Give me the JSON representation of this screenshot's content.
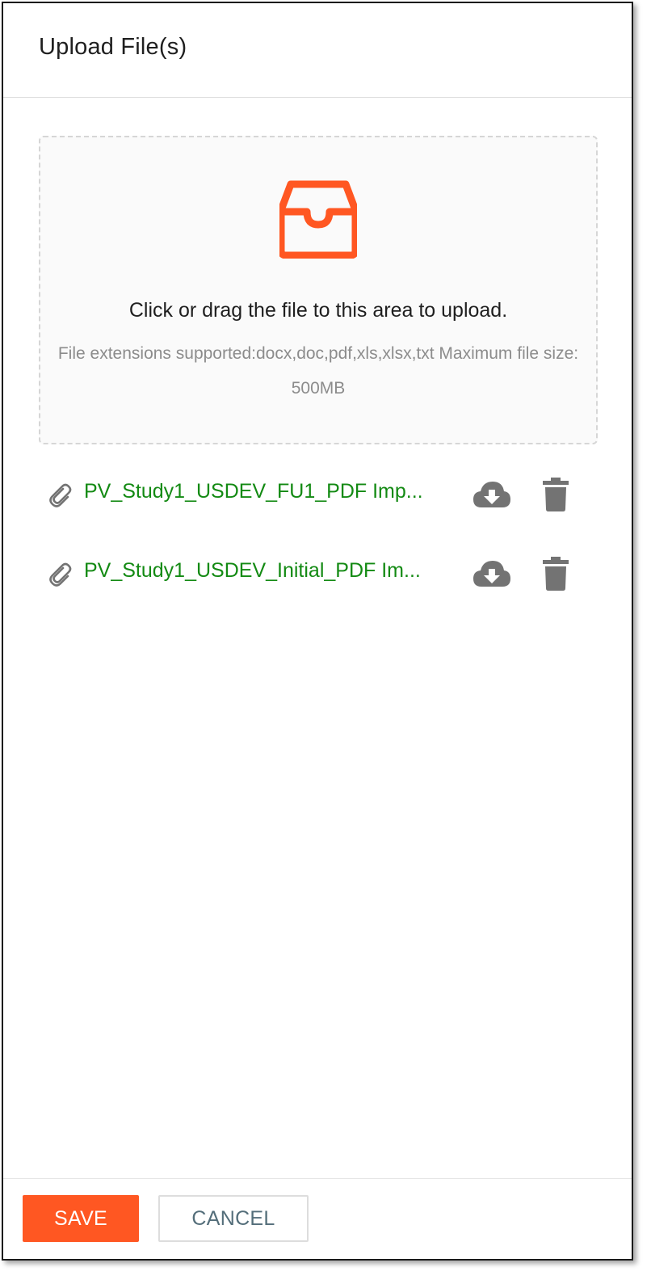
{
  "dialog": {
    "title": "Upload File(s)"
  },
  "dropzone": {
    "icon": "inbox-icon",
    "primary_text": "Click or drag the file to this area to upload.",
    "hint_text": "File extensions supported:docx,doc,pdf,xls,xlsx,txt    Maximum file size: 500MB"
  },
  "files": [
    {
      "name": "PV_Study1_USDEV_FU1_PDF Imp...",
      "attachment_icon": "paperclip-icon",
      "download_icon": "cloud-download-icon",
      "delete_icon": "trash-icon"
    },
    {
      "name": "PV_Study1_USDEV_Initial_PDF Im...",
      "attachment_icon": "paperclip-icon",
      "download_icon": "cloud-download-icon",
      "delete_icon": "trash-icon"
    }
  ],
  "footer": {
    "save_label": "SAVE",
    "cancel_label": "CANCEL"
  },
  "colors": {
    "accent": "#ff5722",
    "file_link": "#138a13",
    "icon_gray": "#737373",
    "hint_gray": "#8c8c8c",
    "cancel_text": "#546e7a"
  }
}
